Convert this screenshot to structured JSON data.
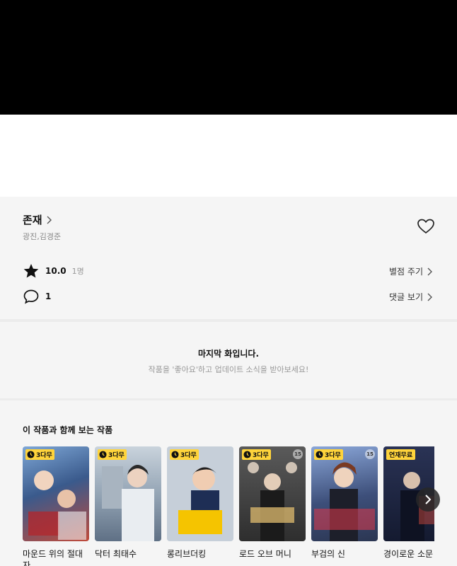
{
  "series": {
    "title": "존재",
    "authors": "광진,김경준"
  },
  "stats": {
    "rating_value": "10.0",
    "rating_count": "1명",
    "rate_link": "별점 주기",
    "comment_count": "1",
    "comment_link": "댓글 보기"
  },
  "last_episode": {
    "title": "마지막 화입니다.",
    "subtitle": "작품을 '좋아요'하고 업데이트 소식을 받아보세요!"
  },
  "recommendations": {
    "heading": "이 작품과 함께 보는 작품",
    "items": [
      {
        "name": "마운드 위의 절대자",
        "badge": "3다무",
        "meta": "",
        "color": "#3a5a8c"
      },
      {
        "name": "닥터 최태수",
        "badge": "3다무",
        "meta": "",
        "color": "#6b7f93"
      },
      {
        "name": "롱리브더킹",
        "badge": "3다무",
        "meta": "",
        "color": "#e8e2d4"
      },
      {
        "name": "로드 오브 머니",
        "badge": "3다무",
        "age": "15",
        "meta": "",
        "color": "#3c3c3c"
      },
      {
        "name": "부검의 신",
        "badge": "3다무",
        "age": "15",
        "meta": "",
        "color": "#2b3652"
      },
      {
        "name": "경이로운 소문",
        "badge": "연재무료",
        "meta": "",
        "color": "#1d2540"
      }
    ]
  },
  "colors": {
    "badge_yellow": "#ffd43b",
    "panel_bg": "#f5f5f5"
  }
}
